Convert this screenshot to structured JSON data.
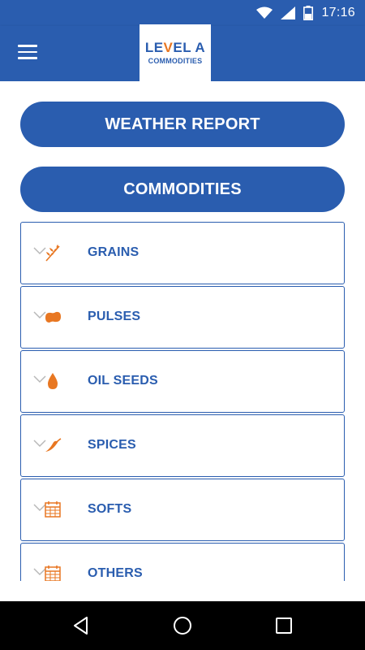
{
  "status_bar": {
    "time": "17:16",
    "icons": [
      "wifi-icon",
      "signal-icon",
      "battery-icon"
    ]
  },
  "app_bar": {
    "menu_icon": "hamburger-menu-icon",
    "logo": {
      "main_prefix": "LE",
      "main_accent": "V",
      "main_suffix": "EL A",
      "sub": "COMMODITIES"
    }
  },
  "buttons": {
    "weather_report": "WEATHER REPORT",
    "commodities": "COMMODITIES"
  },
  "commodities": [
    {
      "label": "GRAINS",
      "icon": "wheat-icon"
    },
    {
      "label": "PULSES",
      "icon": "bean-icon"
    },
    {
      "label": "OIL SEEDS",
      "icon": "oil-drop-icon"
    },
    {
      "label": "SPICES",
      "icon": "chili-pepper-icon"
    },
    {
      "label": "SOFTS",
      "icon": "calendar-grid-icon"
    },
    {
      "label": "OTHERS",
      "icon": "calendar-grid-icon"
    }
  ],
  "colors": {
    "primary": "#2a5daf",
    "accent": "#e87722",
    "chevron": "#b8b8b8",
    "nav_bar": "#000000"
  },
  "nav_bar": {
    "icons": [
      "back-icon",
      "home-icon",
      "recents-icon"
    ]
  }
}
